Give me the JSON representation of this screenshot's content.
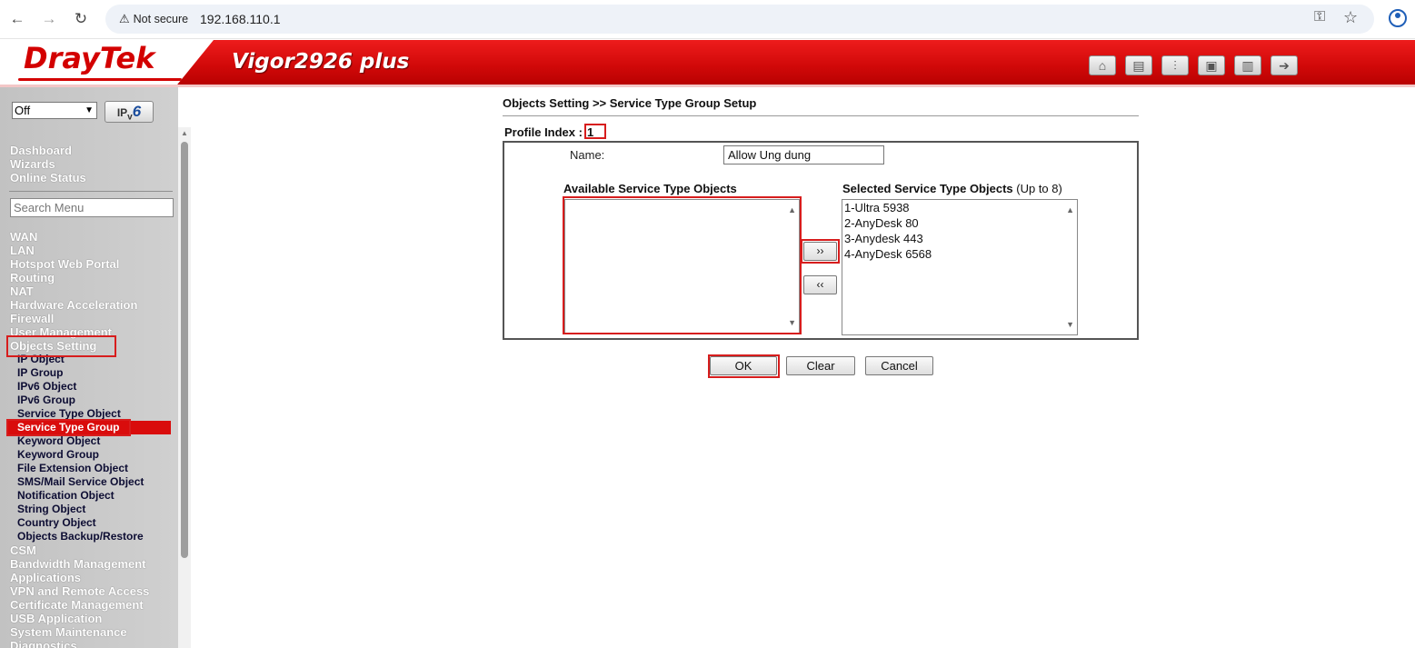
{
  "browser": {
    "security_label": "Not secure",
    "url": "192.168.110.1"
  },
  "banner": {
    "brand": "DrayTek",
    "model": "Vigor2926 plus",
    "toolbar_icons": [
      "home-icon",
      "quick-start-icon",
      "settings-sliders-icon",
      "save-icon",
      "manual-book-icon",
      "logout-icon"
    ],
    "accent_color": "#d30000"
  },
  "sidebar": {
    "mode_select": "Off",
    "ipv6_label_prefix": "IP",
    "ipv6_label_v": "v",
    "ipv6_label_6": "6",
    "top_items": [
      "Dashboard",
      "Wizards",
      "Online Status"
    ],
    "search_placeholder": "Search Menu",
    "items": [
      "WAN",
      "LAN",
      "Hotspot Web Portal",
      "Routing",
      "NAT",
      "Hardware Acceleration",
      "Firewall",
      "User Management",
      "Objects Setting"
    ],
    "sub_items": [
      "IP Object",
      "IP Group",
      "IPv6 Object",
      "IPv6 Group",
      "Service Type Object",
      "Service Type Group",
      "Keyword Object",
      "Keyword Group",
      "File Extension Object",
      "SMS/Mail Service Object",
      "Notification Object",
      "String Object",
      "Country Object",
      "Objects Backup/Restore"
    ],
    "bottom_items": [
      "CSM",
      "Bandwidth Management",
      "Applications",
      "VPN and Remote Access",
      "Certificate Management",
      "USB Application",
      "System Maintenance",
      "Diagnostics"
    ]
  },
  "main": {
    "title": "Objects Setting >> Service Type Group Setup",
    "profile_index_label": "Profile Index :",
    "profile_index_value": "1",
    "name_label": "Name:",
    "name_value": "Allow Ung dung",
    "available_label": "Available Service Type Objects",
    "selected_label": "Selected Service Type Objects",
    "selected_limit": "(Up to 8)",
    "available_objects": [],
    "selected_objects": [
      "1-Ultra 5938",
      "2-AnyDesk 80",
      "3-Anydesk 443",
      "4-AnyDesk 6568"
    ],
    "add_button": "››",
    "remove_button": "‹‹",
    "ok_button": "OK",
    "clear_button": "Clear",
    "cancel_button": "Cancel"
  }
}
